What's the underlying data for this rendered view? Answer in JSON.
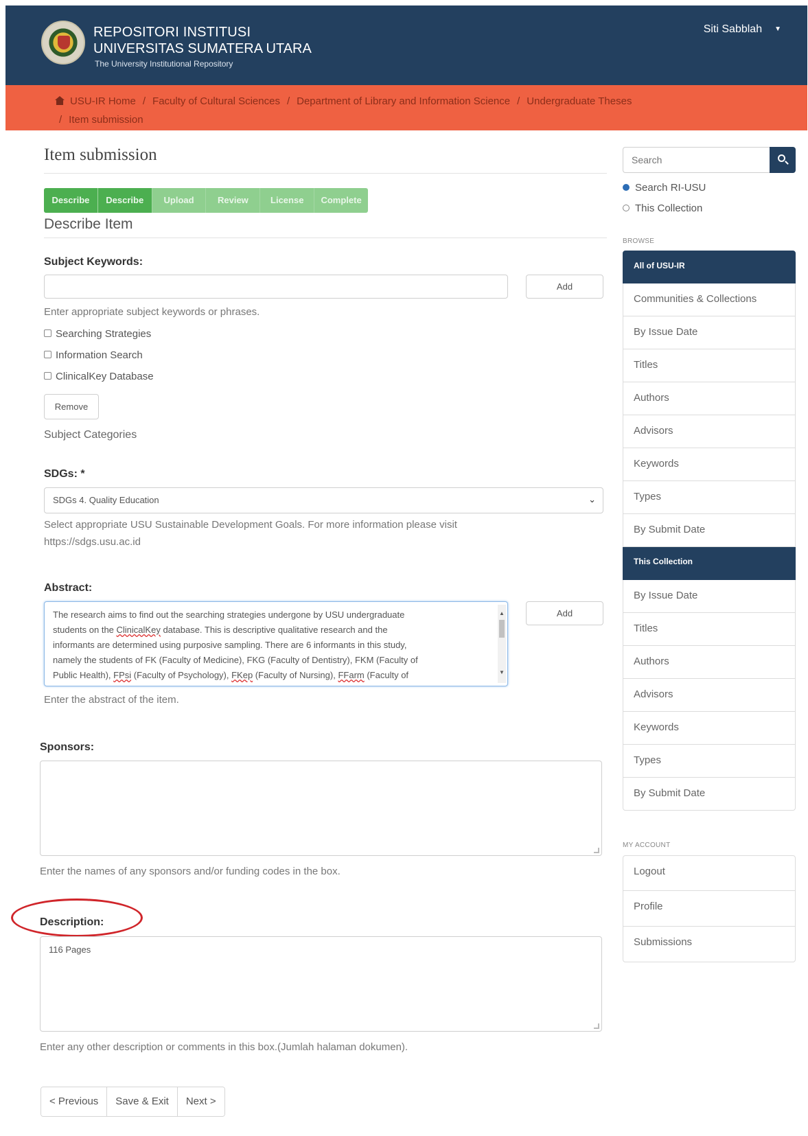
{
  "header": {
    "brand_line1": "REPOSITORI INSTITUSI",
    "brand_line2": "UNIVERSITAS SUMATERA UTARA",
    "brand_tagline": "The University Institutional Repository",
    "user_name": "Siti Sabblah"
  },
  "breadcrumb": {
    "items": [
      "USU-IR Home",
      "Faculty of Cultural Sciences",
      "Department of Library and Information Science",
      "Undergraduate Theses",
      "Item submission"
    ]
  },
  "page": {
    "title": "Item submission",
    "section_title": "Describe Item"
  },
  "progress": {
    "steps": [
      "Describe",
      "Describe",
      "Upload",
      "Review",
      "License",
      "Complete"
    ],
    "completed": 2
  },
  "form": {
    "subject_keywords": {
      "label": "Subject Keywords:",
      "value": "",
      "add_label": "Add",
      "help": "Enter appropriate subject keywords or phrases.",
      "entries": [
        "Searching Strategies",
        "Information Search",
        "ClinicalKey Database"
      ],
      "remove_label": "Remove"
    },
    "subject_categories_label": "Subject Categories",
    "sdgs": {
      "label": "SDGs: *",
      "selected": "SDGs 4. Quality Education",
      "help_line1": "Select appropriate USU Sustainable Development Goals. For more information please visit",
      "help_line2": "https://sdgs.usu.ac.id"
    },
    "abstract": {
      "label": "Abstract:",
      "lines": [
        "The research aims to find out the searching strategies undergone by USU undergraduate",
        "students on the ClinicalKey database. This is descriptive qualitative research and the",
        "informants are determined using purposive sampling. There are 6 informants in this study,",
        "namely the students of FK (Faculty of Medicine), FKG (Faculty of Dentistry), FKM (Faculty of",
        "Public Health), FPsi (Faculty of Psychology), FKep (Faculty of Nursing), FFarm (Faculty of"
      ],
      "add_label": "Add",
      "help": "Enter the abstract of the item."
    },
    "sponsors": {
      "label": "Sponsors:",
      "value": "",
      "help": "Enter the names of any sponsors and/or funding codes in the box."
    },
    "description": {
      "label": "Description:",
      "value": "116 Pages",
      "help": "Enter any other description or comments in this box.(Jumlah halaman dokumen)."
    }
  },
  "pager": {
    "previous": "< Previous",
    "save_exit": "Save & Exit",
    "next": "Next >"
  },
  "sidebar": {
    "search_placeholder": "Search",
    "scope_options": [
      "Search RI-USU",
      "This Collection"
    ],
    "browse_heading": "BROWSE",
    "browse_all_header": "All of USU-IR",
    "browse_all": [
      "Communities & Collections",
      "By Issue Date",
      "Titles",
      "Authors",
      "Advisors",
      "Keywords",
      "Types",
      "By Submit Date"
    ],
    "collection_header": "This Collection",
    "collection_items": [
      "By Issue Date",
      "Titles",
      "Authors",
      "Advisors",
      "Keywords",
      "Types",
      "By Submit Date"
    ],
    "account_heading": "MY ACCOUNT",
    "account_items": [
      "Logout",
      "Profile",
      "Submissions"
    ]
  },
  "colors": {
    "header_bg": "#23405f",
    "breadcrumb_bg": "#ef6142",
    "progress_done": "#4caf50",
    "annotation_circle": "#d0252a"
  }
}
